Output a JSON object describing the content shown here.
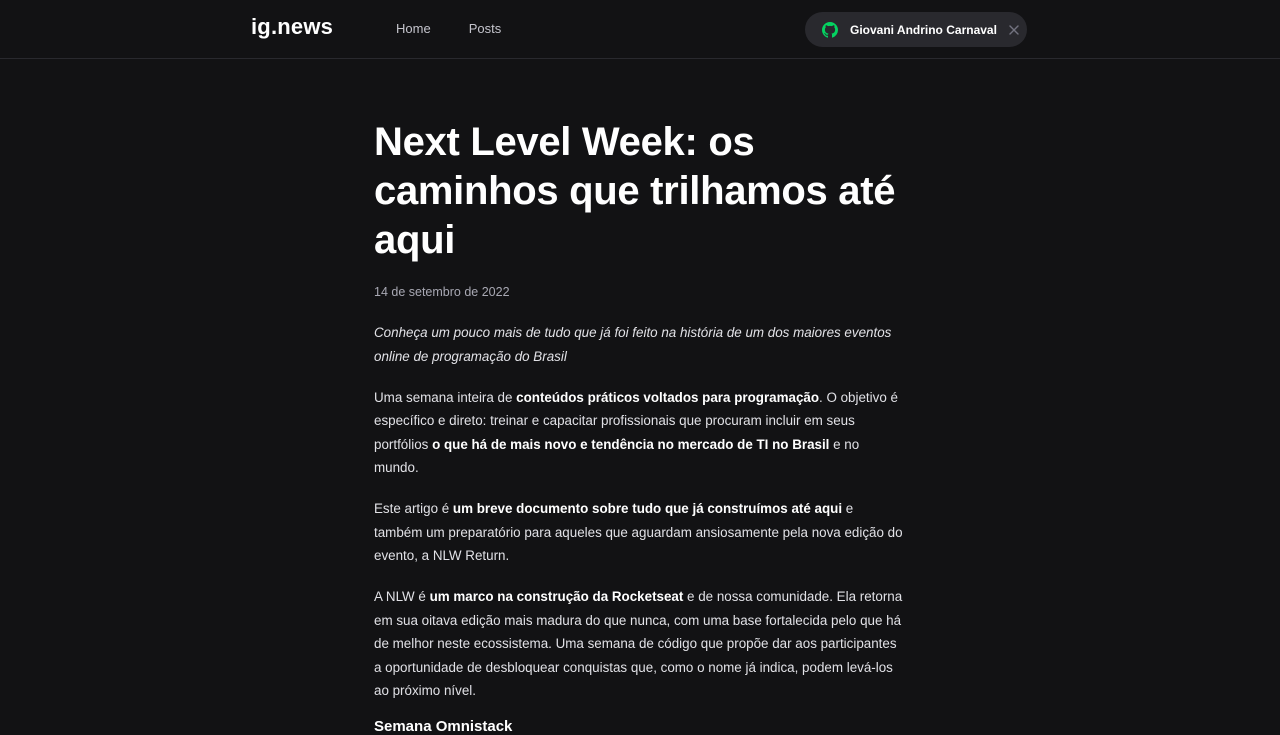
{
  "header": {
    "logo": "ig.news",
    "nav": [
      "Home",
      "Posts"
    ],
    "user_name": "Giovani Andrino Carnaval",
    "icon_github": "github-icon",
    "icon_close": "close-icon",
    "github_color": "#04d361"
  },
  "article": {
    "title": "Next Level Week: os caminhos que trilhamos até aqui",
    "date": "14 de setembro de 2022",
    "lead": "Conheça um pouco mais de tudo que já foi feito na história de um dos maiores eventos online de programação do Brasil",
    "p1": {
      "a": "Uma semana inteira de ",
      "b": "conteúdos práticos voltados para programação",
      "c": ". O objetivo é específico e direto: treinar e capacitar profissionais que procuram incluir em seus portfólios ",
      "d": "o que há de mais novo e tendência no mercado de TI no Brasil",
      "e": " e no mundo."
    },
    "p2": {
      "a": "Este artigo é ",
      "b": "um breve documento sobre tudo que já construímos até aqui",
      "c": " e também um preparatório para aqueles que aguardam ansiosamente pela nova edição do evento, a NLW Return."
    },
    "p3": {
      "a": "A NLW é ",
      "b": "um marco na construção da Rocketseat",
      "c": " e de nossa comunidade. Ela retorna em sua oitava edição mais madura do que nunca, com uma base fortalecida pelo que há de melhor neste ecossistema. Uma semana de código que propõe dar aos participantes a oportunidade de desbloquear conquistas que, como o nome já indica, podem levá-los ao próximo nível."
    },
    "subheading": "Semana Omnistack"
  }
}
